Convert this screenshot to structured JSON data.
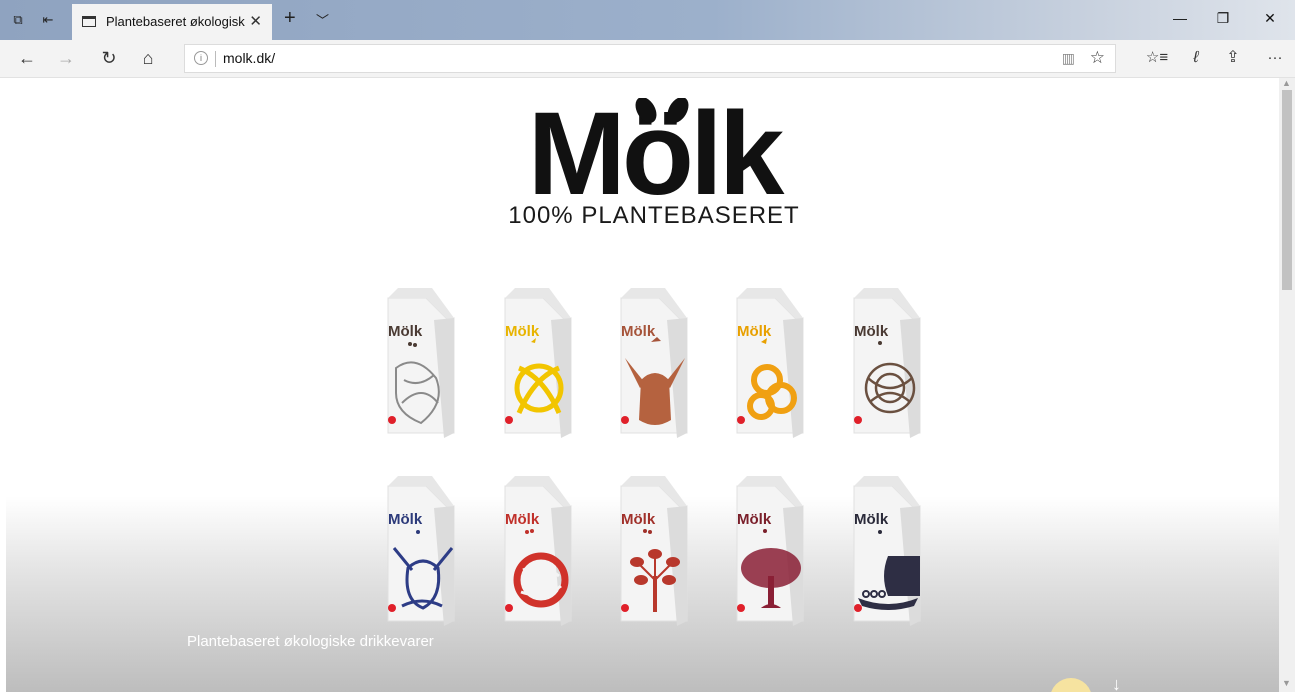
{
  "browser": {
    "tab_title": "Plantebaseret økologisk",
    "url": "molk.dk/"
  },
  "page": {
    "logo_text": "Mölk",
    "tagline": "100% PLANTEBASERET",
    "subtitle": "Plantebaseret økologiske drikkevarer"
  },
  "cartons": [
    {
      "brand": "Mölk",
      "brand_color": "#4a3a33",
      "design": "viking-knot",
      "accent": "#8a8a8a"
    },
    {
      "brand": "Mölk",
      "brand_color": "#e8b400",
      "design": "triquetra",
      "accent": "#f2c500"
    },
    {
      "brand": "Mölk",
      "brand_color": "#a6543a",
      "design": "viking-head",
      "accent": "#b5623f"
    },
    {
      "brand": "Mölk",
      "brand_color": "#e8a000",
      "design": "celtic-knot",
      "accent": "#f0a012"
    },
    {
      "brand": "Mölk",
      "brand_color": "#4a3a33",
      "design": "round-knot",
      "accent": "#6a5040"
    },
    {
      "brand": "Mölk",
      "brand_color": "#2c3a7a",
      "design": "valkyrie",
      "accent": "#2d3c86"
    },
    {
      "brand": "Mölk",
      "brand_color": "#c0302a",
      "design": "ring-knot",
      "accent": "#d0322a"
    },
    {
      "brand": "Mölk",
      "brand_color": "#a0302a",
      "design": "tree",
      "accent": "#b8382c"
    },
    {
      "brand": "Mölk",
      "brand_color": "#7a1f2a",
      "design": "big-tree",
      "accent": "#8a1f35"
    },
    {
      "brand": "Mölk",
      "brand_color": "#2a2a3a",
      "design": "viking-ship",
      "accent": "#2e2e44"
    }
  ],
  "colors": {
    "title_bar": "#9cb0cb",
    "logo": "#111111",
    "organic_badge": "#e0202a"
  }
}
